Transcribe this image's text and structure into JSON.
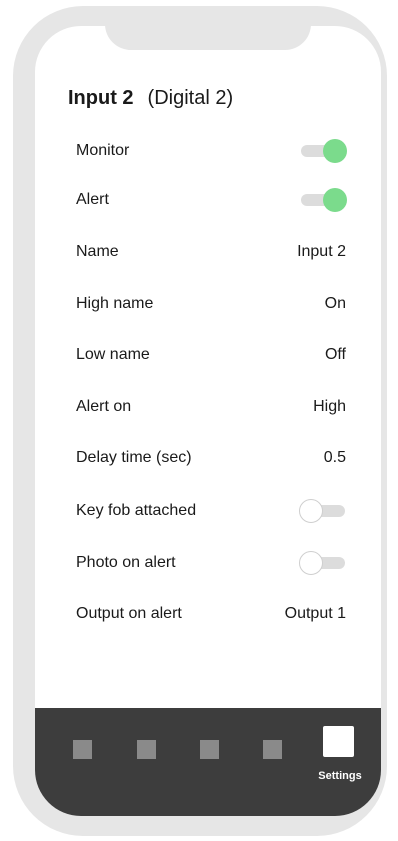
{
  "header": {
    "title": "Input 2",
    "subtitle": "(Digital 2)"
  },
  "settings": [
    {
      "label": "Monitor",
      "type": "toggle",
      "state": "on"
    },
    {
      "label": "Alert",
      "type": "toggle",
      "state": "on"
    },
    {
      "label": "Name",
      "type": "value",
      "value": "Input 2"
    },
    {
      "label": "High name",
      "type": "value",
      "value": "On"
    },
    {
      "label": "Low name",
      "type": "value",
      "value": "Off"
    },
    {
      "label": "Alert on",
      "type": "value",
      "value": "High"
    },
    {
      "label": "Delay time (sec)",
      "type": "value",
      "value": "0.5"
    },
    {
      "label": "Key fob attached",
      "type": "toggle",
      "state": "off"
    },
    {
      "label": "Photo on alert",
      "type": "toggle",
      "state": "off"
    },
    {
      "label": "Output on alert",
      "type": "value",
      "value": "Output 1"
    }
  ],
  "bottom_nav": {
    "active_label": "Settings"
  },
  "colors": {
    "toggle_on": "#7bdb8c",
    "nav_bar": "#3d3d3d",
    "frame": "#e6e6e6"
  }
}
